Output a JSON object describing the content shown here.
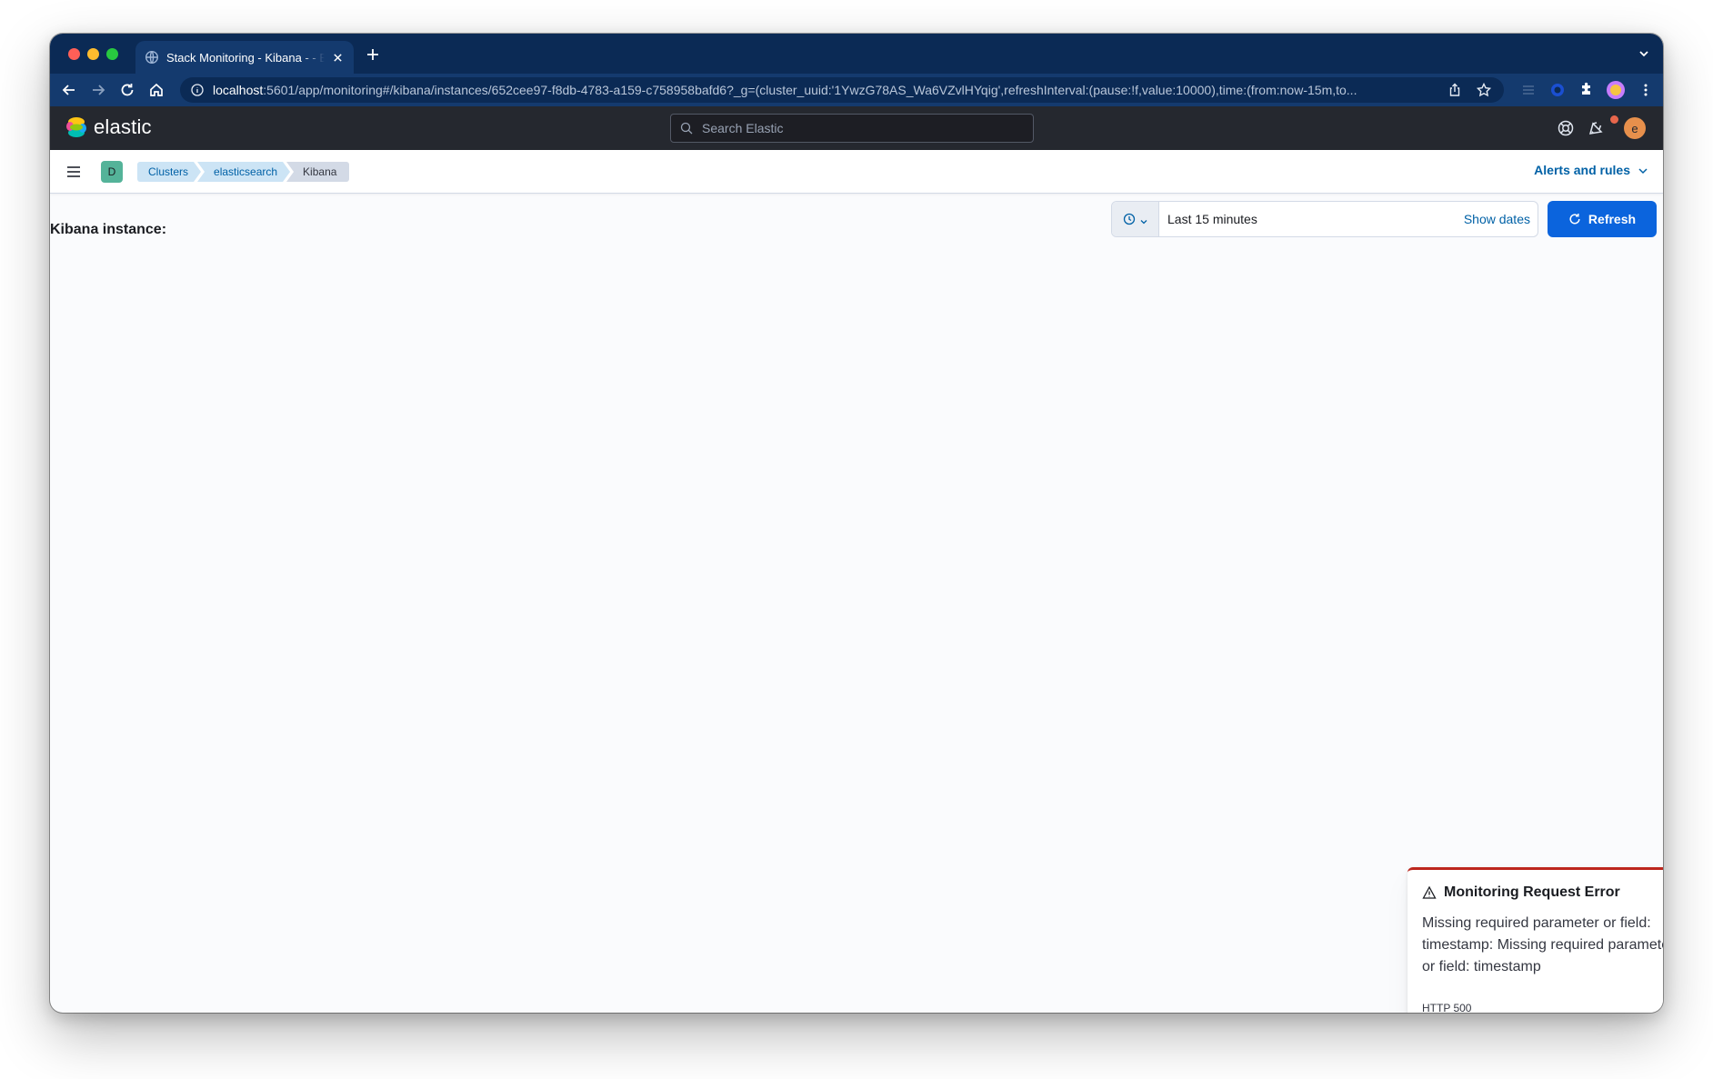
{
  "browser": {
    "tab_title": "Stack Monitoring - Kibana - - Elastic",
    "url_host": "localhost",
    "url_rest": ":5601/app/monitoring#/kibana/instances/652cee97-f8db-4783-a159-c758958bafd6?_g=(cluster_uuid:'1YwzG78AS_Wa6VZvlHYqig',refreshInterval:(pause:!f,value:10000),time:(from:now-15m,to..."
  },
  "header": {
    "logo_text": "elastic",
    "search_placeholder": "Search Elastic",
    "avatar_initial": "e"
  },
  "breadcrumb_bar": {
    "space_initial": "D",
    "crumbs": [
      "Clusters",
      "elasticsearch",
      "Kibana"
    ],
    "alerts_label": "Alerts and rules"
  },
  "page": {
    "title": "Kibana instance:",
    "date_range": "Last 15 minutes",
    "show_dates": "Show dates",
    "refresh": "Refresh"
  },
  "toast": {
    "title": "Monitoring Request Error",
    "message": "Missing required parameter or field: timestamp: Missing required parameter or field: timestamp",
    "code": "HTTP 500",
    "border_color": "#bd271e"
  },
  "colors": {
    "kibana_header": "#25282f",
    "primary": "#0b64dd",
    "link": "#0061a6"
  }
}
